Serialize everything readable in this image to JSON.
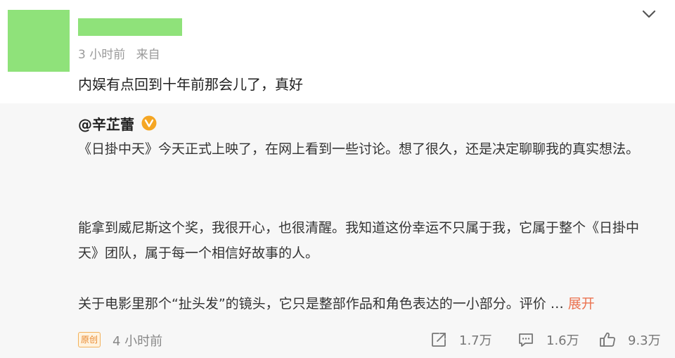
{
  "comment": {
    "time": "3 小时前",
    "source": "来自",
    "text": "内娱有点回到十年前那会儿了，真好"
  },
  "quoted_post": {
    "author": "@辛芷蕾",
    "paragraphs": [
      "《日掛中天》今天正式上映了，在网上看到一些讨论。想了很久，还是决定聊聊我的真实想法。",
      "能拿到威尼斯这个奖，我很开心，也很清醒。我知道这份幸运不只属于我，它属于整个《日掛中天》团队，属于每一个相信好故事的人。",
      "关于电影里那个“扯头发”的镜头，它只是整部作品和角色表达的一小部分。评价 …"
    ],
    "expand_label": "展开",
    "original_badge": "原创",
    "time": "4 小时前",
    "shares": "1.7万",
    "comments": "1.6万",
    "likes": "9.3万"
  },
  "icons": {
    "chevron": "chevron-down-icon",
    "verified": "verified-badge-icon",
    "share": "share-icon",
    "comment": "comment-icon",
    "like": "like-icon"
  },
  "colors": {
    "avatar_placeholder": "#8fe27a",
    "quote_background": "#f7f7f7",
    "expand_link": "#eb7350",
    "verified_badge": "#f5a623"
  }
}
